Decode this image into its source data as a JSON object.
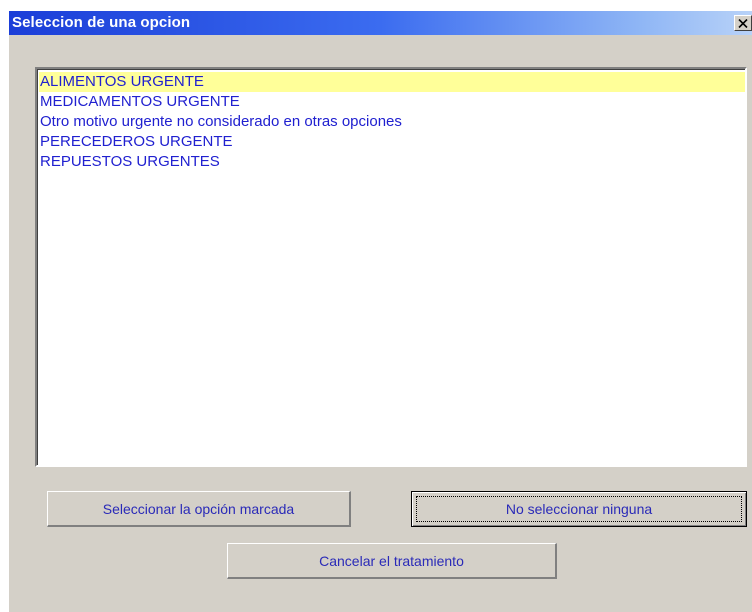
{
  "dialog": {
    "title": "Seleccion de una opcion",
    "close_icon": "close-icon"
  },
  "list": {
    "items": [
      "ALIMENTOS URGENTE",
      "MEDICAMENTOS URGENTE",
      "Otro motivo urgente no considerado en otras opciones",
      "PERECEDEROS URGENTE",
      "REPUESTOS URGENTES"
    ],
    "selected_index": 0
  },
  "buttons": {
    "select_marked": "Seleccionar la opción marcada",
    "select_none": "No seleccionar ninguna",
    "cancel": "Cancelar el  tratamiento"
  },
  "colors": {
    "item_text": "#2020d0",
    "selected_bg": "#ffff99",
    "dialog_bg": "#d4d0c8"
  }
}
